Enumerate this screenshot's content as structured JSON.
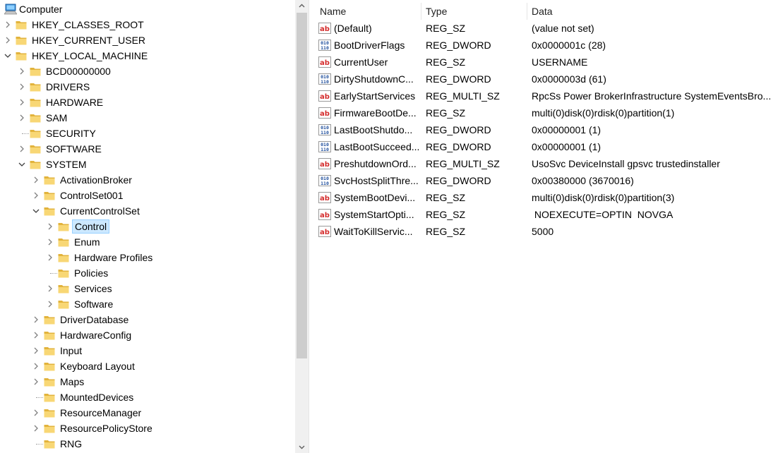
{
  "tree": {
    "root_label": "Computer",
    "nodes": [
      {
        "label": "HKEY_CLASSES_ROOT",
        "depth": 0,
        "expander": "collapsed"
      },
      {
        "label": "HKEY_CURRENT_USER",
        "depth": 0,
        "expander": "collapsed"
      },
      {
        "label": "HKEY_LOCAL_MACHINE",
        "depth": 0,
        "expander": "expanded"
      },
      {
        "label": "BCD00000000",
        "depth": 1,
        "expander": "collapsed"
      },
      {
        "label": "DRIVERS",
        "depth": 1,
        "expander": "collapsed"
      },
      {
        "label": "HARDWARE",
        "depth": 1,
        "expander": "collapsed"
      },
      {
        "label": "SAM",
        "depth": 1,
        "expander": "collapsed"
      },
      {
        "label": "SECURITY",
        "depth": 1,
        "expander": "none"
      },
      {
        "label": "SOFTWARE",
        "depth": 1,
        "expander": "collapsed"
      },
      {
        "label": "SYSTEM",
        "depth": 1,
        "expander": "expanded"
      },
      {
        "label": "ActivationBroker",
        "depth": 2,
        "expander": "collapsed"
      },
      {
        "label": "ControlSet001",
        "depth": 2,
        "expander": "collapsed"
      },
      {
        "label": "CurrentControlSet",
        "depth": 2,
        "expander": "expanded"
      },
      {
        "label": "Control",
        "depth": 3,
        "expander": "collapsed",
        "selected": true
      },
      {
        "label": "Enum",
        "depth": 3,
        "expander": "collapsed"
      },
      {
        "label": "Hardware Profiles",
        "depth": 3,
        "expander": "collapsed"
      },
      {
        "label": "Policies",
        "depth": 3,
        "expander": "none"
      },
      {
        "label": "Services",
        "depth": 3,
        "expander": "collapsed"
      },
      {
        "label": "Software",
        "depth": 3,
        "expander": "collapsed"
      },
      {
        "label": "DriverDatabase",
        "depth": 2,
        "expander": "collapsed"
      },
      {
        "label": "HardwareConfig",
        "depth": 2,
        "expander": "collapsed"
      },
      {
        "label": "Input",
        "depth": 2,
        "expander": "collapsed"
      },
      {
        "label": "Keyboard Layout",
        "depth": 2,
        "expander": "collapsed"
      },
      {
        "label": "Maps",
        "depth": 2,
        "expander": "collapsed"
      },
      {
        "label": "MountedDevices",
        "depth": 2,
        "expander": "none"
      },
      {
        "label": "ResourceManager",
        "depth": 2,
        "expander": "collapsed"
      },
      {
        "label": "ResourcePolicyStore",
        "depth": 2,
        "expander": "collapsed"
      },
      {
        "label": "RNG",
        "depth": 2,
        "expander": "none"
      }
    ]
  },
  "list": {
    "headers": {
      "name": "Name",
      "type": "Type",
      "data": "Data"
    },
    "rows": [
      {
        "name": "(Default)",
        "type": "REG_SZ",
        "data": "(value not set)",
        "icon": "string-value-icon"
      },
      {
        "name": "BootDriverFlags",
        "type": "REG_DWORD",
        "data": "0x0000001c (28)",
        "icon": "binary-value-icon"
      },
      {
        "name": "CurrentUser",
        "type": "REG_SZ",
        "data": "USERNAME",
        "icon": "string-value-icon"
      },
      {
        "name": "DirtyShutdownC...",
        "type": "REG_DWORD",
        "data": "0x0000003d (61)",
        "icon": "binary-value-icon"
      },
      {
        "name": "EarlyStartServices",
        "type": "REG_MULTI_SZ",
        "data": "RpcSs Power BrokerInfrastructure SystemEventsBro...",
        "icon": "string-value-icon"
      },
      {
        "name": "FirmwareBootDe...",
        "type": "REG_SZ",
        "data": "multi(0)disk(0)rdisk(0)partition(1)",
        "icon": "string-value-icon"
      },
      {
        "name": "LastBootShutdo...",
        "type": "REG_DWORD",
        "data": "0x00000001 (1)",
        "icon": "binary-value-icon"
      },
      {
        "name": "LastBootSucceed...",
        "type": "REG_DWORD",
        "data": "0x00000001 (1)",
        "icon": "binary-value-icon"
      },
      {
        "name": "PreshutdownOrd...",
        "type": "REG_MULTI_SZ",
        "data": "UsoSvc DeviceInstall gpsvc trustedinstaller",
        "icon": "string-value-icon"
      },
      {
        "name": "SvcHostSplitThre...",
        "type": "REG_DWORD",
        "data": "0x00380000 (3670016)",
        "icon": "binary-value-icon"
      },
      {
        "name": "SystemBootDevi...",
        "type": "REG_SZ",
        "data": "multi(0)disk(0)rdisk(0)partition(3)",
        "icon": "string-value-icon"
      },
      {
        "name": "SystemStartOpti...",
        "type": "REG_SZ",
        "data": " NOEXECUTE=OPTIN  NOVGA",
        "icon": "string-value-icon"
      },
      {
        "name": "WaitToKillServic...",
        "type": "REG_SZ",
        "data": "5000",
        "icon": "string-value-icon"
      }
    ]
  },
  "colors": {
    "selection_bg": "#cce8ff",
    "folder": "#f8d775",
    "folder_dark": "#e2b33c",
    "string_icon_red": "#d42c2c",
    "binary_icon_blue": "#1f4e9c"
  }
}
